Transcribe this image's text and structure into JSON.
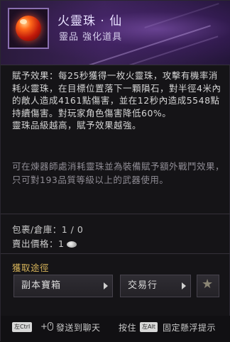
{
  "item": {
    "name": "火靈珠 · 仙",
    "type": "靈品  強化道具"
  },
  "effect": {
    "text1": "賦予效果：每25秒獲得一枚火靈珠，攻擊有機率消耗火靈珠，在目標位置落下一顆隕石，對半徑4米內的敵人造成4161點傷害，並在12秒內造成5548點持續傷害。對玩家角色傷害降低60%。",
    "text2": "靈珠品級越高，賦予效果越強。"
  },
  "description": "可在煉器師處消耗靈珠並為裝備賦予額外戰鬥效果，只可對193品質等級以上的武器使用。",
  "inventory": {
    "label": "包裹/倉庫：",
    "value": "1 / 0"
  },
  "sell_price": {
    "label": "賣出價格：",
    "value": "1"
  },
  "acquire": {
    "title": "獲取途徑",
    "sources": [
      "副本寶箱",
      "交易行"
    ]
  },
  "footer": {
    "key_ctrl": "左Ctrl",
    "plus": "+",
    "send_chat": "發送到聊天",
    "hold": "按住",
    "key_alt": "左Alt",
    "pin": "固定懸浮提示"
  },
  "colors": {
    "accent_gold": "#d6b35a",
    "header_purple": "#3b2357",
    "description_gray": "#8f8c94"
  },
  "icons": {
    "item": "fire-orb-icon",
    "arrow": "chevron-right-icon",
    "favorite": "star-icon",
    "currency": "silver-coin-icon",
    "mouse": "mouse-icon"
  }
}
